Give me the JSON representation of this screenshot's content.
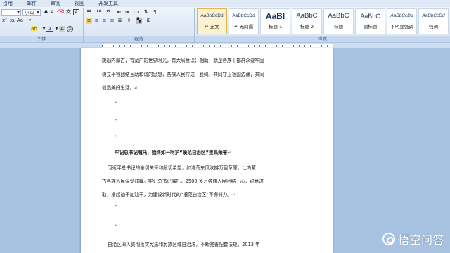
{
  "menu": {
    "items": [
      "引用",
      "邮件",
      "审阅",
      "视图",
      "开发工具"
    ]
  },
  "font_group": {
    "font_name": "",
    "font_size": "小四",
    "label": "字体"
  },
  "para_group": {
    "label": "段落"
  },
  "styles_group": {
    "label": "样式",
    "items": [
      {
        "sample": "AaBbCcDd",
        "name": "↵ 正文",
        "active": true
      },
      {
        "sample": "AaBbCcDd",
        "name": "↵ 无间隔",
        "active": false
      },
      {
        "sample": "AaBl",
        "name": "标题 1",
        "active": false
      },
      {
        "sample": "AaBbC",
        "name": "标题 2",
        "active": false
      },
      {
        "sample": "AaBbC",
        "name": "标题",
        "active": false
      },
      {
        "sample": "AaBbC",
        "name": "副标题",
        "active": false
      },
      {
        "sample": "AaBbCcDd",
        "name": "不明显强调",
        "active": false
      },
      {
        "sample": "AaBbCcDd",
        "name": "强调",
        "active": false
      }
    ]
  },
  "document": {
    "paragraphs": [
      "跳出内蒙古，有宽广的世界眼光，有大局意识；相助，就是各族干部群众要牢固",
      "树立平等团结互助和谐的思想，各族人民拧成一股绳，共同守卫祖国边疆，共同",
      "创造美好生活。",
      "牢记总书记嘱托，始终如一呵护“模范自治区”崇高荣誉",
      "习近平总书记的亲切关怀和殷切希望，如浩荡东风吹拂万里草原，让内蒙",
      "古各族人民深受鼓舞。牢记总书记嘱托，2500 多万各族人民团结一心，锐意进",
      "取，撸起袖子加油干，为建设新时代的“模范自治区”不懈努力。",
      "自治区深入贯彻落实宪法和民族区域自治法，不断完善配套法规。2013 年"
    ],
    "para_mark": "↵"
  },
  "watermark": {
    "text": "悟空问答"
  }
}
